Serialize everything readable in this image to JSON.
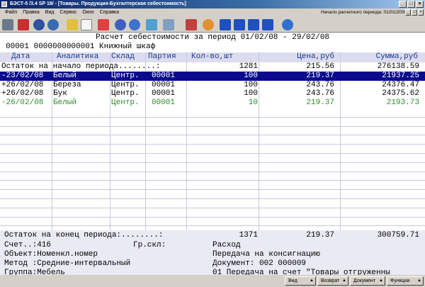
{
  "window": {
    "title": "БЭСТ-5 /3.4 SP 18/ - [Товары. Продукция-Бухгалтерская себестоимость]"
  },
  "menu": [
    "Файл",
    "Правка",
    "Вид",
    "Сервис",
    "Окно",
    "Справка"
  ],
  "period_label": "Начало расчетного периода: 01/01/2008",
  "report": {
    "title": "Расчет себестоимости за период 01/02/08 - 29/02/08",
    "item": "00001 0000000000001 Книжный шкаф"
  },
  "columns": [
    "Дата",
    "Аналитика",
    "Склад",
    "Партия",
    "Кол-во,шт",
    "Цена,руб",
    "Сумма,руб"
  ],
  "opening": {
    "label": "Остаток на начало периода........:",
    "qty": "1281",
    "price": "215.56",
    "sum": "276138.59"
  },
  "rows": [
    {
      "date": "-23/02/08",
      "analytics": "Белый",
      "warehouse": "Центр.",
      "batch": "00001",
      "qty": "100",
      "price": "219.37",
      "sum": "21937.25",
      "style": "sel"
    },
    {
      "date": "+26/02/08",
      "analytics": "Береза",
      "warehouse": "Центр.",
      "batch": "00001",
      "qty": "100",
      "price": "243.76",
      "sum": "24376.47",
      "style": ""
    },
    {
      "date": "+26/02/08",
      "analytics": "Бук",
      "warehouse": "Центр.",
      "batch": "00001",
      "qty": "100",
      "price": "243.76",
      "sum": "24375.62",
      "style": ""
    },
    {
      "date": "-26/02/08",
      "analytics": "Белый",
      "warehouse": "Центр.",
      "batch": "00001",
      "qty": "10",
      "price": "219.37",
      "sum": "2193.73",
      "style": "green"
    }
  ],
  "closing": {
    "label": "Остаток на конец периода:........:",
    "qty": "1371",
    "price": "219.37",
    "sum": "300759.71"
  },
  "details": {
    "account": "Счет..:416",
    "group_wh": "Гр.скл:",
    "operation_type": "Расход",
    "object": "Объект:Номенкл.номер",
    "operation": "Передача на консигнацию",
    "method": "Метод :Средние-интервальный",
    "document": "Документ: 002 000009",
    "group": "Группа:Мебель",
    "posting": "01 Передача на счет \"Товары отгруженны"
  },
  "buttons": {
    "view": "Вид",
    "return": "Возврат",
    "document": "Документ",
    "functions": "Функции"
  },
  "colors": {
    "selection": "#0a0a8c",
    "header_bg": "#dcdcf0",
    "green": "#2e8b2e"
  }
}
